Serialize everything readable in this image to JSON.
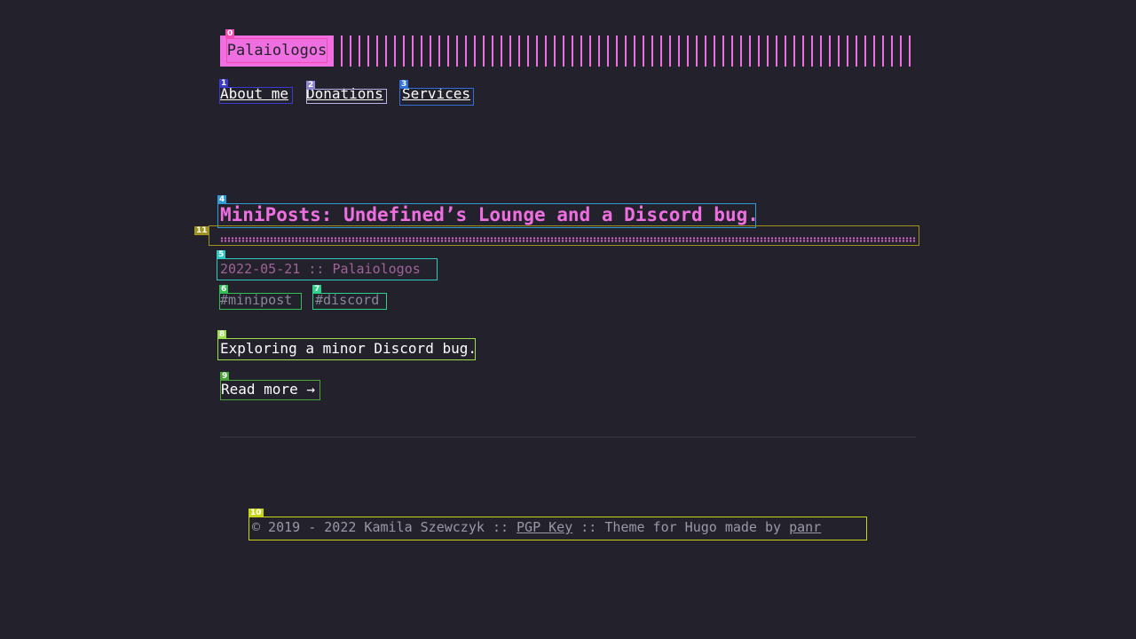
{
  "header": {
    "logo_text": "Palaiologos"
  },
  "nav": {
    "items": [
      {
        "label": "About me"
      },
      {
        "label": "Donations"
      },
      {
        "label": "Services"
      }
    ]
  },
  "post": {
    "title": "MiniPosts: Undefined’s Lounge and a Discord bug.",
    "date": "2022-05-21",
    "separator": "::",
    "author": "Palaiologos",
    "tags": [
      "#minipost",
      "#discord"
    ],
    "excerpt": "Exploring a minor Discord bug.",
    "read_more": "Read more →"
  },
  "footer": {
    "copyright": "© 2019 - 2022 Kamila Szewczyk",
    "sep1": "::",
    "pgp_label": "PGP Key",
    "sep2": "::",
    "theme_text": "Theme for Hugo made by",
    "theme_author": "panr"
  },
  "annotations": [
    "0",
    "1",
    "2",
    "3",
    "4",
    "5",
    "6",
    "7",
    "8",
    "9",
    "10",
    "11"
  ],
  "colors": {
    "background": "#22212c",
    "accent": "#ef6fe1",
    "text": "#ffffff",
    "muted": "#9a98a7"
  }
}
